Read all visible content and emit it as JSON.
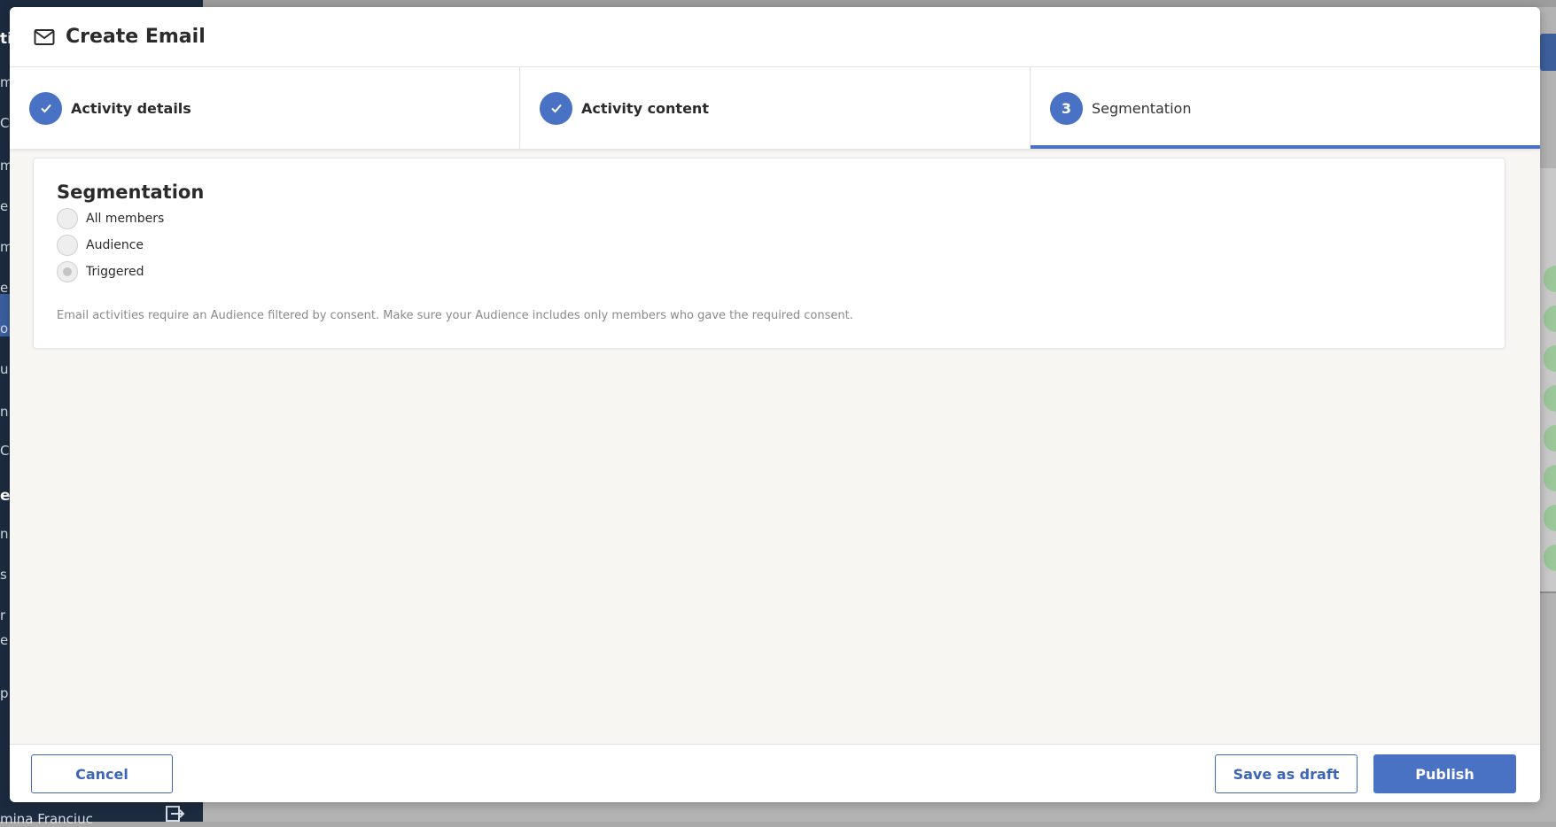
{
  "background": {
    "sidebar_fragments": [
      "ti",
      "m",
      "C",
      "m",
      "e",
      "m",
      "e",
      "o",
      "u",
      "n",
      "C",
      "e",
      "n",
      "s",
      "r",
      "e",
      "p"
    ],
    "user_name": "mina Franciuc"
  },
  "modal": {
    "title": "Create Email",
    "icon": "envelope-icon"
  },
  "steps": [
    {
      "label": "Activity details",
      "state": "complete"
    },
    {
      "label": "Activity content",
      "state": "complete"
    },
    {
      "label": "Segmentation",
      "number": "3",
      "state": "active"
    }
  ],
  "segmentation": {
    "title": "Segmentation",
    "options": [
      {
        "label": "All members",
        "selected": false
      },
      {
        "label": "Audience",
        "selected": false
      },
      {
        "label": "Triggered",
        "selected": true
      }
    ],
    "hint": "Email activities require an Audience filtered by consent. Make sure your Audience includes only members who gave the required consent."
  },
  "footer": {
    "cancel_label": "Cancel",
    "save_draft_label": "Save as draft",
    "publish_label": "Publish"
  },
  "colors": {
    "accent": "#4a72c4",
    "button_outline": "#3d66b5"
  }
}
